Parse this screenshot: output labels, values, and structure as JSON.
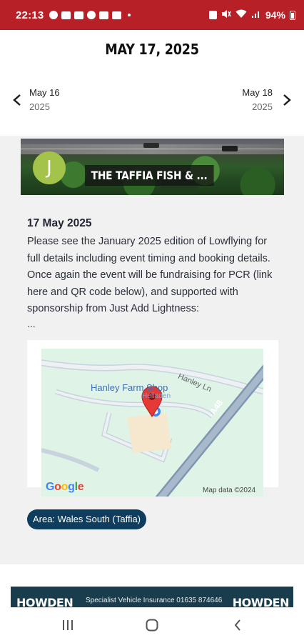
{
  "status_bar": {
    "time": "22:13",
    "battery": "94%",
    "icon_names": [
      "face-icon",
      "sky-news-icon",
      "app-icon",
      "app-icon",
      "app-icon",
      "app-icon",
      "dot-icon",
      "alarm-icon",
      "mute-icon",
      "wifi-icon",
      "signal-icon",
      "battery-icon"
    ],
    "background": "#b72027"
  },
  "header": {
    "title": "MAY 17, 2025",
    "prev": {
      "date": "May 16",
      "year": "2025"
    },
    "next": {
      "date": "May 18",
      "year": "2025"
    }
  },
  "post": {
    "banner_title": "THE TAFFIA FISH & ...",
    "avatar_letter": "J",
    "avatar_color": "#a3c34a",
    "date": "17 May 2025",
    "body": "Please see the January 2025 edition of Lowflying for full details including event timing and booking details. Once again the event will be fundraising for PCR (link here and QR code below), and supported with sponsorship from Just Add Lightness:",
    "ellipsis": "...",
    "map": {
      "place": "Hanley Farm Shop",
      "sub_label": "Hefladen",
      "road_label": "Hanley Ln",
      "highway_label": "A48",
      "logo": "Google",
      "attribution": "Map data ©2024"
    },
    "tag": "Area: Wales South (Taffia)"
  },
  "ad": {
    "brand": "HOWDEN",
    "text": "Specialist Vehicle Insurance 01635 874646",
    "background": "#1a3d4e"
  },
  "colors": {
    "accent": "#b72027",
    "tag": "#0e3d5e",
    "content_bg": "#f1f1f1"
  }
}
